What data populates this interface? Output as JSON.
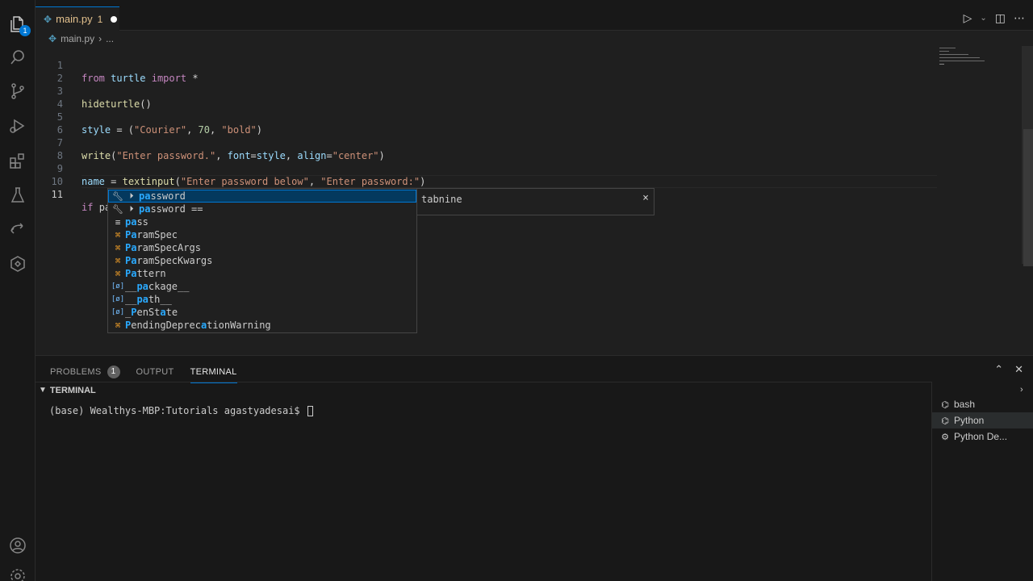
{
  "tab": {
    "file_name": "main.py",
    "problem_count": "1"
  },
  "breadcrumb": {
    "file": "main.py",
    "rest": "..."
  },
  "editor": {
    "lines": [
      {
        "n": "1"
      },
      {
        "n": "2"
      },
      {
        "n": "3"
      },
      {
        "n": "4"
      },
      {
        "n": "5"
      },
      {
        "n": "6"
      },
      {
        "n": "7"
      },
      {
        "n": "8"
      },
      {
        "n": "9"
      },
      {
        "n": "10"
      },
      {
        "n": "11"
      }
    ],
    "tokens": {
      "l1": [
        "from",
        "turtle",
        "import",
        "*"
      ],
      "l3": [
        "hideturtle",
        "()"
      ],
      "l5": [
        "style",
        " = (",
        "\"Courier\"",
        ", ",
        "70",
        ", ",
        "\"bold\"",
        ")"
      ],
      "l7": [
        "write",
        "(",
        "\"Enter password.\"",
        ", ",
        "font",
        "=",
        "style",
        ", ",
        "align",
        "=",
        "\"center\"",
        ")"
      ],
      "l9": [
        "name",
        " = ",
        "textinput",
        "(",
        "\"Enter password below\"",
        ", ",
        "\"Enter password:\"",
        ")"
      ],
      "l11": [
        "if",
        "pa"
      ]
    }
  },
  "suggest": {
    "items": [
      {
        "match": "pa",
        "rest": "ssword",
        "icon": "wrench-snippet"
      },
      {
        "match": "pa",
        "rest": "ssword ==",
        "icon": "wrench-snippet"
      },
      {
        "match": "pa",
        "rest": "ss",
        "icon": "keyword"
      },
      {
        "match": "Pa",
        "rest": "ramSpec",
        "icon": "class"
      },
      {
        "match": "Pa",
        "rest": "ramSpecArgs",
        "icon": "class"
      },
      {
        "match": "Pa",
        "rest": "ramSpecKwargs",
        "icon": "class"
      },
      {
        "match": "Pa",
        "rest": "ttern",
        "icon": "class"
      },
      {
        "pre": "__",
        "match": "pa",
        "rest": "ckage__",
        "icon": "variable"
      },
      {
        "pre": "__",
        "match": "pa",
        "rest": "th__",
        "icon": "variable"
      },
      {
        "pre": "_",
        "match": "P",
        "mid": "enSt",
        "match2": "a",
        "rest": "te",
        "icon": "variable"
      },
      {
        "match": "P",
        "mid": "endingDeprec",
        "match2": "a",
        "rest": "tionWarning",
        "icon": "class"
      }
    ],
    "details_source": "tabnine",
    "close": "×"
  },
  "panel": {
    "tabs": [
      {
        "label": "PROBLEMS",
        "badge": "1"
      },
      {
        "label": "OUTPUT"
      },
      {
        "label": "TERMINAL"
      }
    ],
    "terminal_header": "TERMINAL",
    "prompt": "(base) Wealthys-MBP:Tutorials agastyadesai$ ",
    "terminals": [
      "bash",
      "Python",
      "Python De..."
    ]
  },
  "icons": {
    "activity": [
      "files-icon",
      "search-icon",
      "source-control-icon",
      "run-debug-icon",
      "extensions-icon",
      "testing-icon",
      "remote-icon",
      "docker-icon",
      "account-icon",
      "gear-icon"
    ],
    "accent": "#0078d4"
  },
  "activity_badge": "1"
}
